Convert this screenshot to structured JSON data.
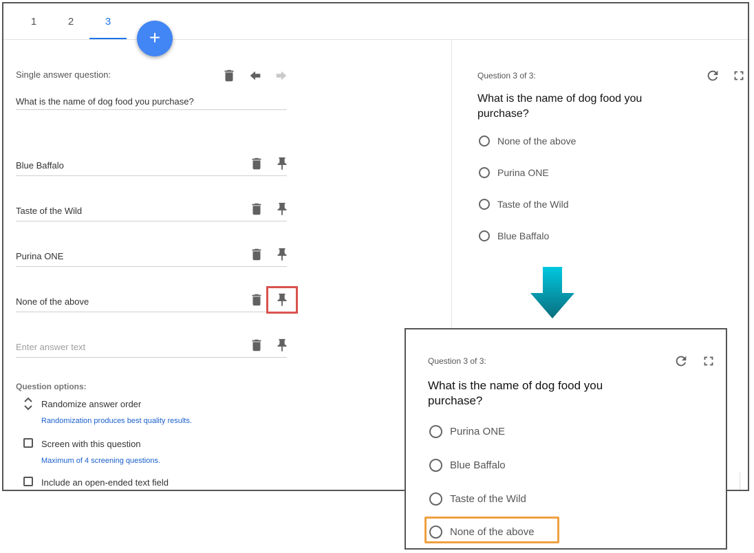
{
  "tabs": [
    {
      "label": "1"
    },
    {
      "label": "2"
    },
    {
      "label": "3"
    }
  ],
  "fab_label": "+",
  "editor": {
    "question_type_label": "Single answer question:",
    "question_text": "What is the name of dog food you purchase?",
    "answers": [
      {
        "text": "Blue Baffalo"
      },
      {
        "text": "Taste of the Wild"
      },
      {
        "text": "Purina ONE"
      },
      {
        "text": "None of the above"
      }
    ],
    "new_answer_placeholder": "Enter answer text",
    "options_title": "Question options:",
    "options": {
      "randomize": "Randomize answer order",
      "randomize_hint": "Randomization produces best quality results.",
      "screen": "Screen with this question",
      "screen_hint": "Maximum of 4 screening questions.",
      "open_ended": "Include an open-ended text field"
    }
  },
  "preview": {
    "counter": "Question 3 of 3:",
    "question_line1": "What is the name of dog food you",
    "question_line2": "purchase?",
    "choices": [
      {
        "label": "None of the above"
      },
      {
        "label": "Purina ONE"
      },
      {
        "label": "Taste of the Wild"
      },
      {
        "label": "Blue Baffalo"
      }
    ]
  },
  "preview_after": {
    "counter": "Question 3 of 3:",
    "question_line1": "What is the name of dog food you",
    "question_line2": "purchase?",
    "choices": [
      {
        "label": "Purina ONE"
      },
      {
        "label": "Blue Baffalo"
      },
      {
        "label": "Taste of the Wild"
      },
      {
        "label": "None of the above"
      }
    ]
  },
  "colors": {
    "accent": "#1a73e8",
    "fab": "#4285f4",
    "pin_highlight": "#d9534f",
    "choice_highlight": "#f0a040",
    "arrow_top": "#00c8e0",
    "arrow_bottom": "#0a6e7e"
  },
  "icons": [
    "trash-icon",
    "arrow-left-icon",
    "arrow-right-icon",
    "pin-icon",
    "refresh-icon",
    "fullscreen-icon",
    "chevron-updown-icon",
    "arrow-down-icon"
  ]
}
